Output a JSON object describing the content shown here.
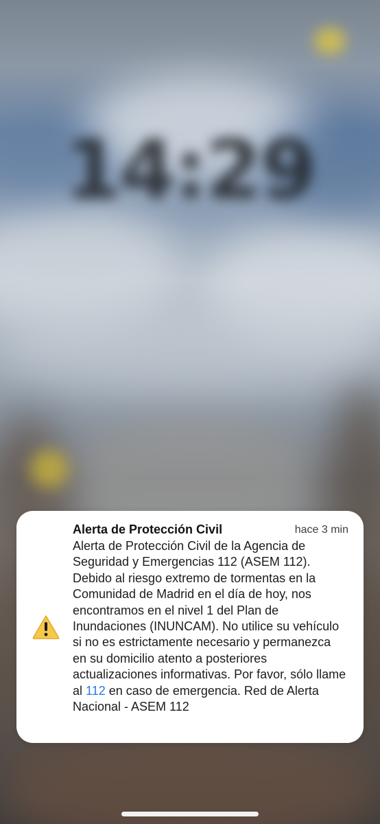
{
  "lock_screen": {
    "clock": "14:29"
  },
  "notification": {
    "title": "Alerta de Protección Civil",
    "time": "hace 3 min",
    "icon": "warning-triangle-icon",
    "body_before_link": "Alerta de Protección Civil de la Agencia de Seguridad y Emergencias 112 (ASEM 112). Debido al riesgo extremo de tormentas en la Comunidad de Madrid en el día de hoy, nos encontramos en el nivel 1 del Plan de Inundaciones (INUNCAM). No utilice su vehículo si no es estrictamente necesario y permanezca en su domicilio atento a posteriores actualizaciones informativas. Por favor, sólo llame al",
    "link_text": "112",
    "body_after_link": "en caso de emergencia. Red de Alerta Nacional - ASEM 112"
  },
  "colors": {
    "card": "#ffffff",
    "link": "#2a7ae2",
    "warning_fill": "#f7c948"
  }
}
